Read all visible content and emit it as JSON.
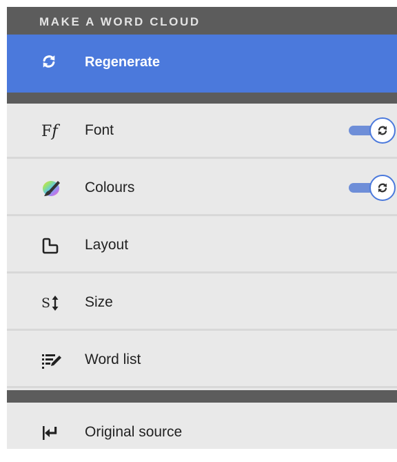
{
  "panel": {
    "title": "MAKE A WORD CLOUD",
    "regenerate_label": "Regenerate",
    "accent_color": "#4b79dc",
    "items": [
      {
        "label": "Font",
        "icon": "font-icon",
        "toggle": true
      },
      {
        "label": "Colours",
        "icon": "palette-icon",
        "toggle": true
      },
      {
        "label": "Layout",
        "icon": "layout-icon",
        "toggle": false
      },
      {
        "label": "Size",
        "icon": "size-icon",
        "toggle": false
      },
      {
        "label": "Word list",
        "icon": "word-list-icon",
        "toggle": false
      }
    ],
    "footer_item": {
      "label": "Original source",
      "icon": "return-arrow-icon"
    }
  }
}
